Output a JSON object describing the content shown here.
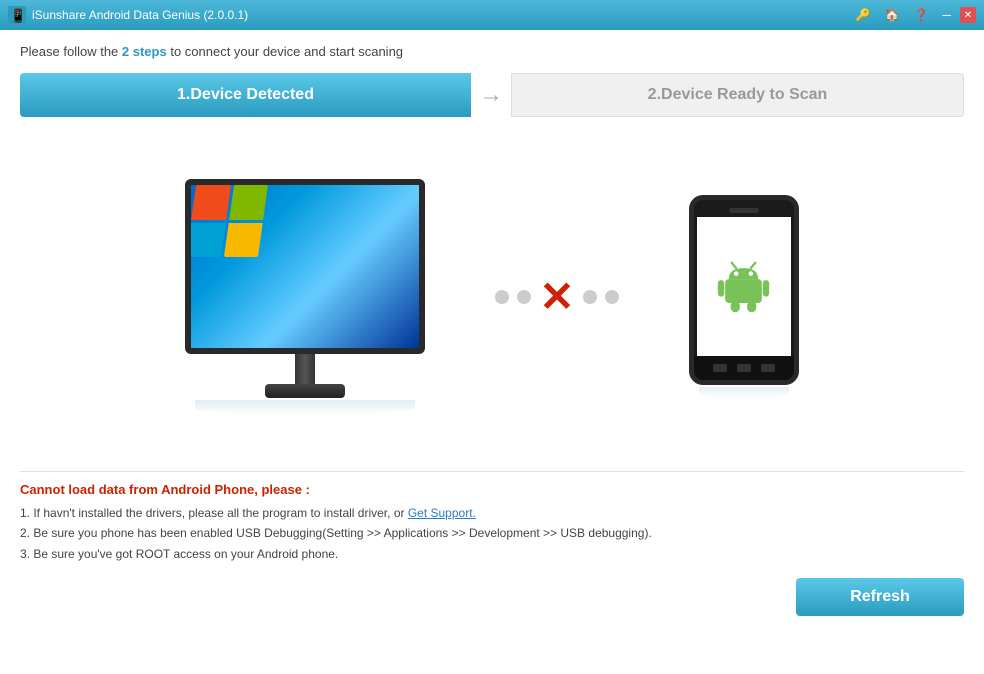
{
  "titleBar": {
    "appName": "iSunshare Android Data Genius (2.0.0.1)"
  },
  "introText": {
    "prefix": "Please follow the ",
    "highlight": "2 steps",
    "suffix": " to connect your device and start scaning"
  },
  "steps": {
    "step1": "1.Device Detected",
    "step2": "2.Device Ready to Scan"
  },
  "errorSection": {
    "title": "Cannot load data from Android Phone, please :",
    "items": [
      {
        "text_before": "If havn't installed the drivers, please all the program to install driver, or ",
        "link": "Get Support.",
        "text_after": ""
      },
      {
        "text": "Be sure you phone has been enabled USB Debugging(Setting >> Applications >> Development >> USB debugging)."
      },
      {
        "text": "Be sure you've got ROOT access on your Android phone."
      }
    ]
  },
  "refreshButton": {
    "label": "Refresh"
  }
}
